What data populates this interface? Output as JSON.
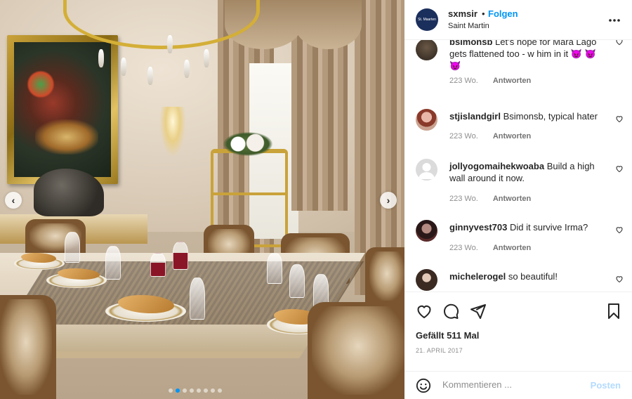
{
  "header": {
    "avatar_text": "St. Maarten Sotheby's",
    "username": "sxmsir",
    "separator": "•",
    "follow_label": "Folgen",
    "location": "Saint Martin",
    "more_icon": "more-horizontal-icon"
  },
  "photo": {
    "nav_prev": "‹",
    "nav_next": "›",
    "slide_count": 8,
    "active_slide": 1
  },
  "comments": [
    {
      "username": "bsimonsb",
      "text": "Let’s hope for Mara Lago gets flattened too - w him in it 😈 😈😈",
      "time": "223 Wo.",
      "reply": "Antworten"
    },
    {
      "username": "stjislandgirl",
      "text": "Bsimonsb, typical hater",
      "time": "223 Wo.",
      "reply": "Antworten"
    },
    {
      "username": "jollyogomaihekwoaba",
      "text": "Build a high wall around it now.",
      "time": "223 Wo.",
      "reply": "Antworten"
    },
    {
      "username": "ginnyvest703",
      "text": "Did it survive Irma?",
      "time": "223 Wo.",
      "reply": "Antworten"
    },
    {
      "username": "michelerogel",
      "text": "so beautiful!",
      "time": "",
      "reply": ""
    }
  ],
  "actions": {
    "like_icon": "heart-icon",
    "comment_icon": "comment-icon",
    "share_icon": "send-icon",
    "save_icon": "bookmark-icon"
  },
  "likes_text": "Gefällt 511 Mal",
  "date_text": "21. APRIL 2017",
  "composer": {
    "emoji_icon": "emoji-icon",
    "placeholder": "Kommentieren ...",
    "post_label": "Posten"
  },
  "colors": {
    "accent": "#0095f6",
    "post_disabled": "#b3dbff",
    "muted": "#8e8e8e"
  }
}
